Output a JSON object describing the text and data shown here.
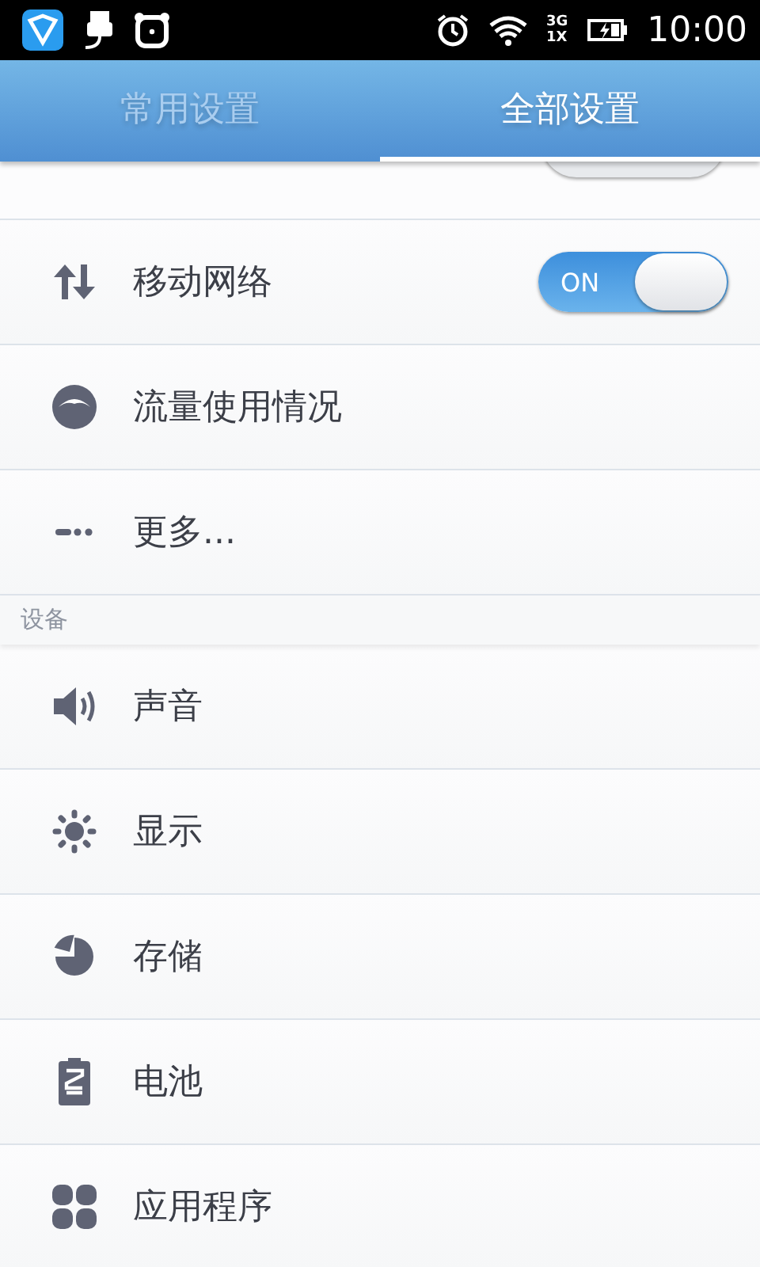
{
  "status_bar": {
    "network_top": "3G",
    "network_bottom": "1X",
    "time": "10:00"
  },
  "tabs": [
    {
      "label": "常用设置",
      "selected": false
    },
    {
      "label": "全部设置",
      "selected": true
    }
  ],
  "sections": [
    {
      "items": [
        {
          "kind": "toggle",
          "label": "移动网络",
          "on": true,
          "switch_text": "ON"
        },
        {
          "kind": "link",
          "label": "流量使用情况"
        },
        {
          "kind": "link",
          "label": "更多..."
        }
      ]
    },
    {
      "header": "设备",
      "items": [
        {
          "kind": "link",
          "label": "声音"
        },
        {
          "kind": "link",
          "label": "显示"
        },
        {
          "kind": "link",
          "label": "存储"
        },
        {
          "kind": "link",
          "label": "电池"
        },
        {
          "kind": "link",
          "label": "应用程序"
        }
      ]
    }
  ]
}
